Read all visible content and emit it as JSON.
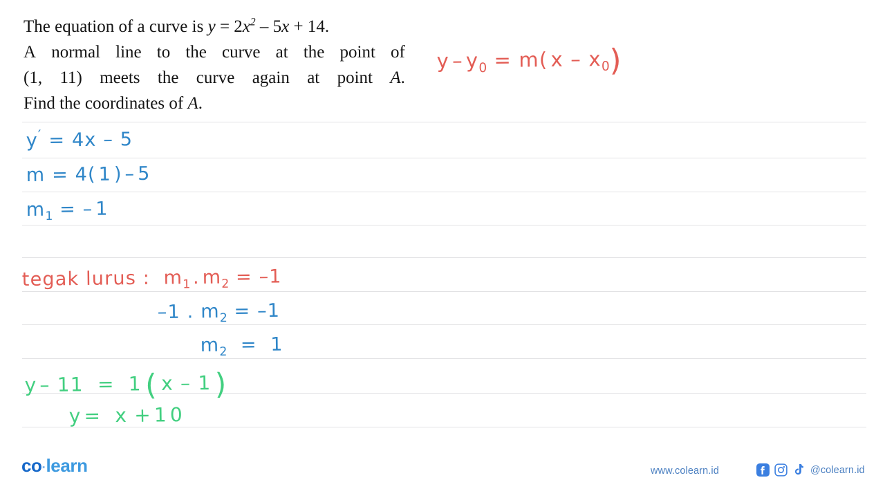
{
  "problem": {
    "line1_a": "The equation of a curve is ",
    "line1_eq_y": "y",
    "line1_eq_rest1": " = 2",
    "line1_eq_x": "x",
    "line1_eq_sup": "2",
    "line1_eq_rest2": " – 5",
    "line1_eq_x2": "x",
    "line1_eq_rest3": " + 14.",
    "line2": "A normal line to the curve at the point of",
    "line3_a": "(1, 11) meets the curve again at point ",
    "line3_var": "A",
    "line3_b": ".",
    "line4_a": "Find the coordinates of ",
    "line4_var": "A",
    "line4_b": "."
  },
  "work": {
    "point_slope_formula": "y - y₀ = m( x - x₀)",
    "derivative": "y' = 4x - 5",
    "slope_substitute": "m = 4( 1 ) - 5",
    "slope_value": "m₁ = -1",
    "perpendicular_label": "tegak lurus :",
    "perpendicular_rule": "m₁ . m₂ = -1",
    "perpendicular_substitute": "-1 . m₂ = -1",
    "perpendicular_result": "m₂ = 1",
    "normal_point_slope": "y - 11 = 1 ( x - 1 )",
    "normal_equation": "y = x + 10"
  },
  "footer": {
    "logo_co": "co",
    "logo_dot": "·",
    "logo_learn": "learn",
    "website": "www.colearn.id",
    "handle": "@colearn.id",
    "facebook_icon": "facebook-icon",
    "instagram_icon": "instagram-icon",
    "tiktok_icon": "tiktok-icon"
  },
  "colors": {
    "red_ink": "#e35d55",
    "blue_ink": "#2f86c8",
    "green_ink": "#42cf80",
    "rule_line": "#e2e2e4",
    "logo_co": "#1668c9",
    "logo_learn": "#3d9ae0",
    "footer_text": "#4a7fc1"
  }
}
